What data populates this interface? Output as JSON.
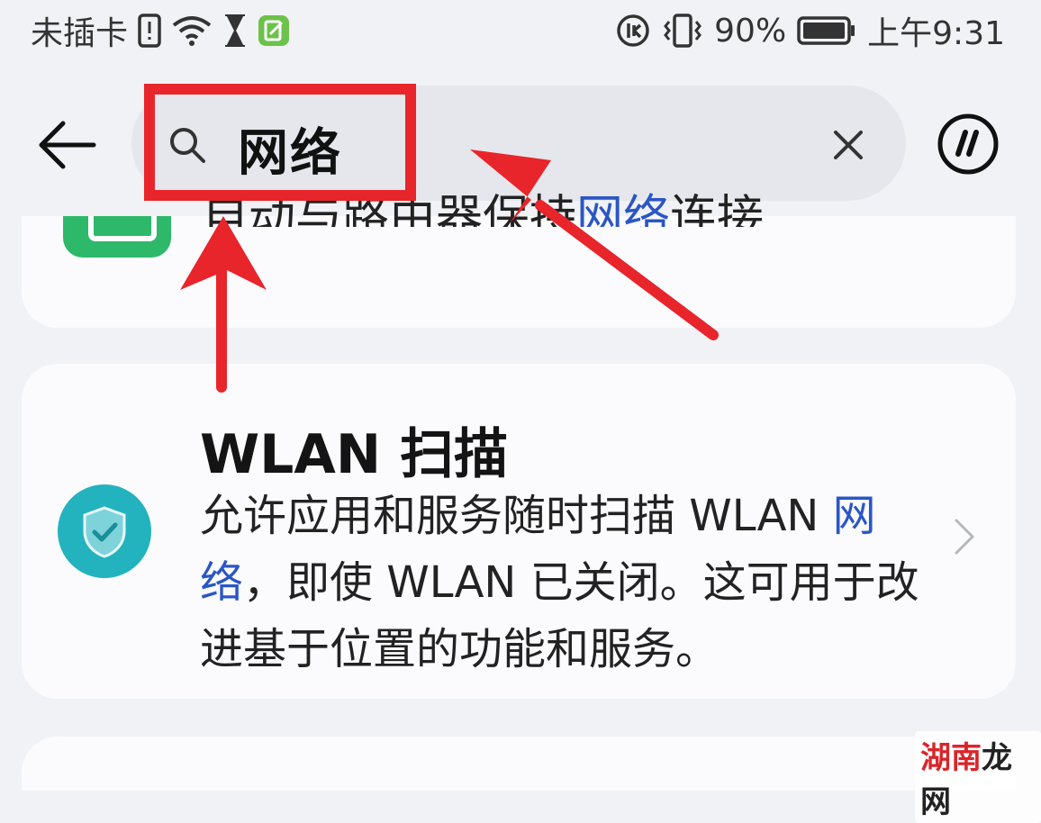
{
  "status_bar": {
    "carrier": "未插卡",
    "battery_percent": "90%",
    "time": "上午9:31"
  },
  "search": {
    "query": "网络"
  },
  "result_partial": {
    "text_before": "自动与路由器保持",
    "text_highlight": "网络",
    "text_after": "连接"
  },
  "result_wlan_scan": {
    "title": "WLAN 扫描",
    "desc_before": "允许应用和服务随时扫描 WLAN ",
    "desc_highlight": "网络",
    "desc_after": "，即使 WLAN 已关闭。这可用于改进基于位置的功能和服务。"
  },
  "watermark": {
    "part1": "湖南",
    "part2": "龙网"
  },
  "colors": {
    "annotation_red": "#e8252b",
    "highlight_blue": "#2a56c6",
    "shield_icon_bg": "#22b3bf",
    "partial_icon_bg": "#2db86a"
  }
}
